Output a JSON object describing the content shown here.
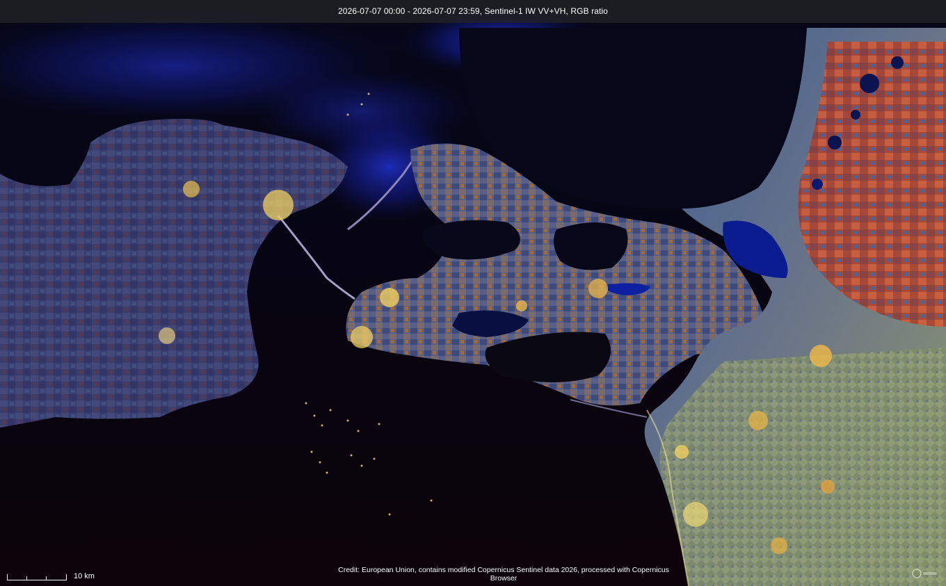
{
  "header": {
    "title": "2026-07-07 00:00 - 2026-07-07 23:59, Sentinel-1 IW VV+VH, RGB ratio"
  },
  "scale": {
    "label": "10 km"
  },
  "credit": {
    "text": "Credit: European Union, contains modified Copernicus Sentinel data 2026, processed with Copernicus Browser"
  },
  "icons": {
    "logo": "copernicus-logo-icon"
  },
  "colors": {
    "sea": "#0a0410",
    "sea_upper": "#06081c",
    "sar_blue_noise": "#1a2cff",
    "land_base": "#3a4272",
    "land_warm": "#c04a2a",
    "urban_yellow": "#f0d060",
    "lagoon": "#0a1a80",
    "steppe_green": "#8a9a6a"
  }
}
